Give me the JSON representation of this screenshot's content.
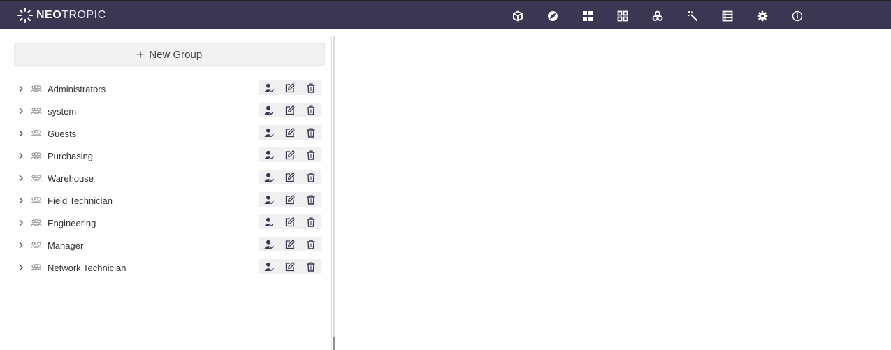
{
  "app": {
    "logo_bold": "NEO",
    "logo_light": "TROPIC"
  },
  "nav": [
    {
      "name": "cube-icon",
      "title": ""
    },
    {
      "name": "compass-icon",
      "title": ""
    },
    {
      "name": "dashboard-icon",
      "title": ""
    },
    {
      "name": "grid-outline-icon",
      "title": ""
    },
    {
      "name": "share-nodes-icon",
      "title": ""
    },
    {
      "name": "magic-wand-icon",
      "title": ""
    },
    {
      "name": "list-icon",
      "title": ""
    },
    {
      "name": "gear-icon",
      "title": ""
    },
    {
      "name": "info-icon",
      "title": ""
    }
  ],
  "toolbar": {
    "new_group_label": "New Group"
  },
  "groups": [
    {
      "label": "Administrators"
    },
    {
      "label": "system"
    },
    {
      "label": "Guests"
    },
    {
      "label": "Purchasing"
    },
    {
      "label": "Warehouse"
    },
    {
      "label": "Field Technician"
    },
    {
      "label": "Engineering"
    },
    {
      "label": "Manager"
    },
    {
      "label": "Network Technician"
    }
  ],
  "colors": {
    "topbar": "#3b3652",
    "icon_dark": "#3b3652"
  }
}
